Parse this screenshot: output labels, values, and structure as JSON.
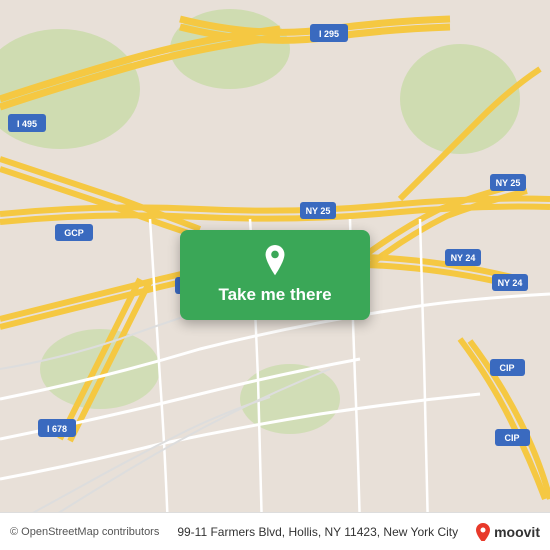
{
  "map": {
    "background_color": "#e8e0d8",
    "alt": "Street map of Hollis, NY area"
  },
  "cta_button": {
    "label": "Take me there",
    "pin_icon": "location-pin-icon",
    "bg_color": "#3aa757"
  },
  "bottom_bar": {
    "copyright": "© OpenStreetMap contributors",
    "address": "99-11 Farmers Blvd, Hollis, NY 11423, New York City",
    "logo": "moovit"
  }
}
